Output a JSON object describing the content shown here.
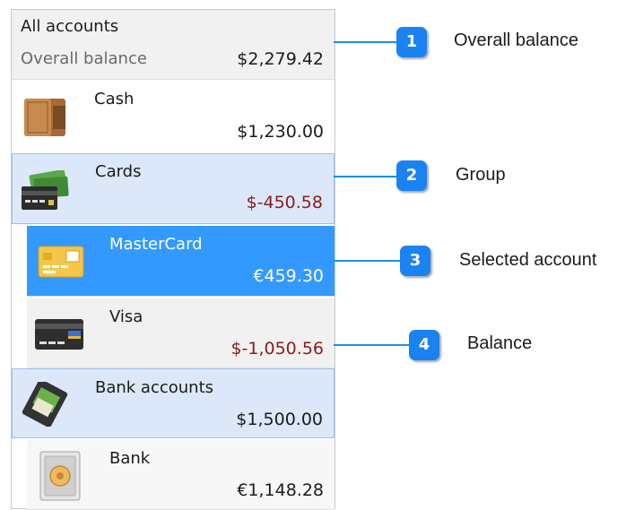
{
  "header": {
    "title": "All accounts",
    "subtitle": "Overall balance",
    "amount": "$2,279.42"
  },
  "items": [
    {
      "name": "Cash",
      "amount": "$1,230.00",
      "icon": "wallet-icon"
    },
    {
      "name": "Cards",
      "amount": "$-450.58",
      "icon": "cards-group-icon"
    },
    {
      "name": "MasterCard",
      "amount": "€459.30",
      "icon": "mastercard-icon"
    },
    {
      "name": "Visa",
      "amount": "$-1,050.56",
      "icon": "visa-card-icon"
    },
    {
      "name": "Bank accounts",
      "amount": "$1,500.00",
      "icon": "bank-accounts-icon"
    },
    {
      "name": "Bank",
      "amount": "€1,148.28",
      "icon": "safe-icon"
    }
  ],
  "callouts": [
    {
      "number": "1",
      "label": "Overall balance"
    },
    {
      "number": "2",
      "label": "Group"
    },
    {
      "number": "3",
      "label": "Selected account"
    },
    {
      "number": "4",
      "label": "Balance"
    }
  ],
  "colors": {
    "selected": "#3399ff",
    "group_bg": "#dce8f9",
    "negative": "#8b1b1b",
    "callout": "#1b82f2"
  }
}
